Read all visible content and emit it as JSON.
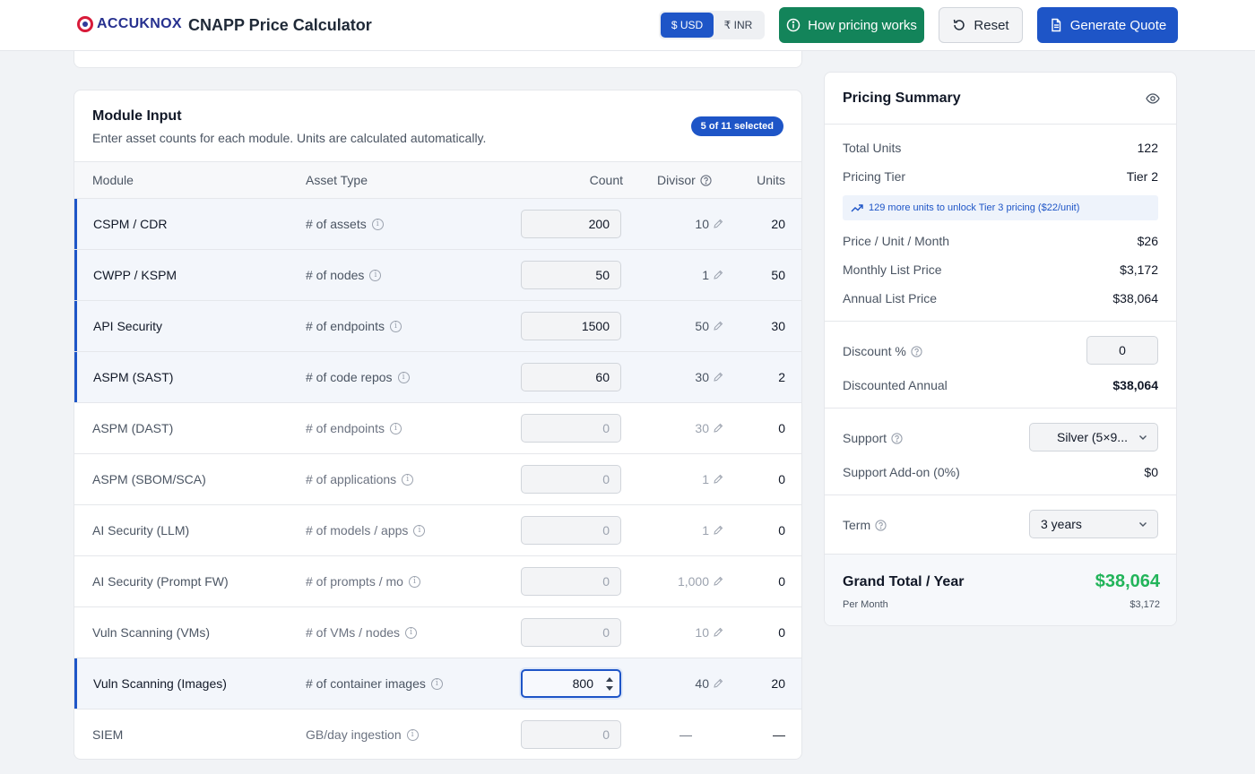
{
  "header": {
    "logo_text": "ACCUKNOX",
    "app_title": "CNAPP Price Calculator",
    "currency": {
      "usd_label": "$ USD",
      "inr_label": "₹ INR",
      "selected": "USD"
    },
    "how_pricing_label": "How pricing works",
    "reset_label": "Reset",
    "generate_quote_label": "Generate Quote",
    "accent_color": "#1e55c7",
    "green_color": "#13845a"
  },
  "module_input": {
    "title": "Module Input",
    "subtitle": "Enter asset counts for each module. Units are calculated automatically.",
    "badge": "5 of 11 selected",
    "columns": {
      "module": "Module",
      "asset_type": "Asset Type",
      "count": "Count",
      "divisor": "Divisor",
      "units": "Units"
    },
    "rows": [
      {
        "module": "CSPM / CDR",
        "asset_type": "# of assets",
        "count": "200",
        "divisor": "10",
        "units": "20",
        "selected": true
      },
      {
        "module": "CWPP / KSPM",
        "asset_type": "# of nodes",
        "count": "50",
        "divisor": "1",
        "units": "50",
        "selected": true
      },
      {
        "module": "API Security",
        "asset_type": "# of endpoints",
        "count": "1500",
        "divisor": "50",
        "units": "30",
        "selected": true
      },
      {
        "module": "ASPM (SAST)",
        "asset_type": "# of code repos",
        "count": "60",
        "divisor": "30",
        "units": "2",
        "selected": true
      },
      {
        "module": "ASPM (DAST)",
        "asset_type": "# of endpoints",
        "count": "0",
        "divisor": "30",
        "units": "0",
        "selected": false
      },
      {
        "module": "ASPM (SBOM/SCA)",
        "asset_type": "# of applications",
        "count": "0",
        "divisor": "1",
        "units": "0",
        "selected": false
      },
      {
        "module": "AI Security (LLM)",
        "asset_type": "# of models / apps",
        "count": "0",
        "divisor": "1",
        "units": "0",
        "selected": false
      },
      {
        "module": "AI Security (Prompt FW)",
        "asset_type": "# of prompts / mo",
        "count": "0",
        "divisor": "1,000",
        "units": "0",
        "selected": false
      },
      {
        "module": "Vuln Scanning (VMs)",
        "asset_type": "# of VMs / nodes",
        "count": "0",
        "divisor": "10",
        "units": "0",
        "selected": false
      },
      {
        "module": "Vuln Scanning (Images)",
        "asset_type": "# of container images",
        "count": "800",
        "divisor": "40",
        "units": "20",
        "selected": true,
        "focused": true
      },
      {
        "module": "SIEM",
        "asset_type": "GB/day ingestion",
        "count": "0",
        "divisor": "—",
        "units": "—",
        "selected": false
      }
    ]
  },
  "summary": {
    "title": "Pricing Summary",
    "total_units_label": "Total Units",
    "total_units": "122",
    "tier_label": "Pricing Tier",
    "tier": "Tier 2",
    "tip": "129 more units to unlock Tier 3 pricing ($22/unit)",
    "price_unit_label": "Price / Unit / Month",
    "price_unit": "$26",
    "monthly_label": "Monthly List Price",
    "monthly": "$3,172",
    "annual_label": "Annual List Price",
    "annual": "$38,064",
    "discount_label": "Discount %",
    "discount": "0",
    "discounted_label": "Discounted Annual",
    "discounted": "$38,064",
    "support_label": "Support",
    "support": "Silver (5×9...",
    "support_addon_label": "Support Add-on (0%)",
    "support_addon": "$0",
    "term_label": "Term",
    "term": "3 years",
    "grand_label": "Grand Total / Year",
    "grand": "$38,064",
    "per_month_label": "Per Month",
    "per_month": "$3,172",
    "grand_color": "#22b45a"
  }
}
